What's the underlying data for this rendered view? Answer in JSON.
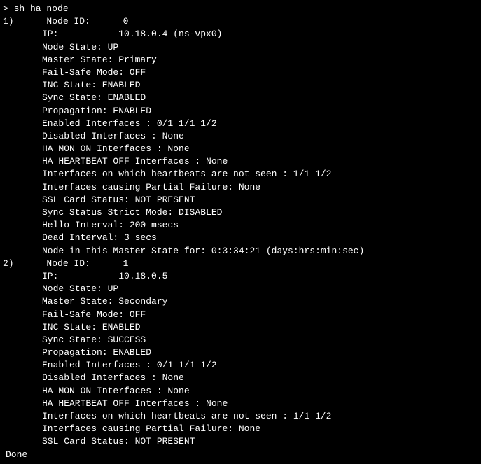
{
  "prompt": "> sh ha node",
  "nodes": [
    {
      "index": "1)",
      "node_id_label": "Node ID:",
      "node_id_value": "0",
      "ip_label": "IP:",
      "ip_value": "10.18.0.4 (ns-vpx0)",
      "fields": [
        "Node State: UP",
        "Master State: Primary",
        "Fail-Safe Mode: OFF",
        "INC State: ENABLED",
        "Sync State: ENABLED",
        "Propagation: ENABLED",
        "Enabled Interfaces : 0/1 1/1 1/2",
        "Disabled Interfaces : None",
        "HA MON ON Interfaces : None",
        "HA HEARTBEAT OFF Interfaces : None",
        "Interfaces on which heartbeats are not seen : 1/1 1/2",
        "Interfaces causing Partial Failure: None",
        "SSL Card Status: NOT PRESENT",
        "Sync Status Strict Mode: DISABLED",
        "Hello Interval: 200 msecs",
        "Dead Interval: 3 secs",
        "Node in this Master State for: 0:3:34:21 (days:hrs:min:sec)"
      ]
    },
    {
      "index": "2)",
      "node_id_label": "Node ID:",
      "node_id_value": "1",
      "ip_label": "IP:",
      "ip_value": "10.18.0.5",
      "fields": [
        "Node State: UP",
        "Master State: Secondary",
        "Fail-Safe Mode: OFF",
        "INC State: ENABLED",
        "Sync State: SUCCESS",
        "Propagation: ENABLED",
        "Enabled Interfaces : 0/1 1/1 1/2",
        "Disabled Interfaces : None",
        "HA MON ON Interfaces : None",
        "HA HEARTBEAT OFF Interfaces : None",
        "Interfaces on which heartbeats are not seen : 1/1 1/2",
        "Interfaces causing Partial Failure: None",
        "SSL Card Status: NOT PRESENT"
      ]
    }
  ],
  "done": " Done"
}
